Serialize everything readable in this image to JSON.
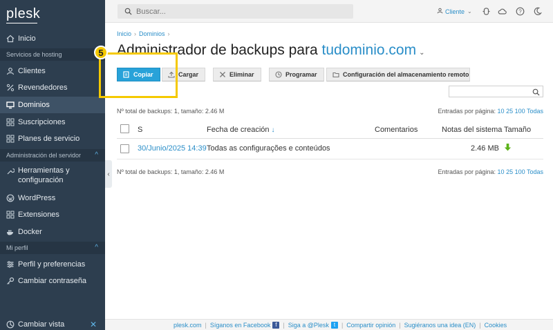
{
  "sidebar": {
    "logo": "plesk",
    "items": [
      {
        "label": "Inicio",
        "icon": "home-icon"
      },
      {
        "section": "Servicios de hosting"
      },
      {
        "label": "Clientes",
        "icon": "user-icon"
      },
      {
        "label": "Revendedores",
        "icon": "percent-icon"
      },
      {
        "label": "Dominios",
        "icon": "monitor-icon",
        "active": true
      },
      {
        "label": "Suscripciones",
        "icon": "grid-icon"
      },
      {
        "label": "Planes de servicio",
        "icon": "grid-icon"
      },
      {
        "section": "Administración del servidor"
      },
      {
        "label": "Herramientas y configuración",
        "icon": "tools-icon"
      },
      {
        "label": "WordPress",
        "icon": "wordpress-icon"
      },
      {
        "label": "Extensiones",
        "icon": "puzzle-icon"
      },
      {
        "label": "Docker",
        "icon": "docker-icon"
      },
      {
        "section": "Mi perfil"
      },
      {
        "label": "Perfil y preferencias",
        "icon": "profile-icon"
      },
      {
        "label": "Cambiar contraseña",
        "icon": "key-icon"
      }
    ],
    "change_view": "Cambiar vista"
  },
  "topbar": {
    "search_placeholder": "Buscar...",
    "user_label": "Cliente"
  },
  "breadcrumb": [
    "Inicio",
    "Dominios"
  ],
  "title": {
    "prefix": "Administrador de backups para",
    "domain": "tudominio.com"
  },
  "step_badge": "5",
  "toolbar": {
    "copy": "Copiar",
    "upload": "Cargar",
    "delete": "Eliminar",
    "schedule": "Programar",
    "remote_storage": "Configuración del almacenamiento remoto"
  },
  "summary": "Nº total de backups: 1, tamaño: 2.46 M",
  "per_page": {
    "label": "Entradas por página:",
    "options": [
      "10",
      "25",
      "100",
      "Todas"
    ]
  },
  "table": {
    "headers": {
      "s": "S",
      "created": "Fecha de creación",
      "sort_indicator": "↓",
      "comments": "Comentarios",
      "notes": "Notas del sistema",
      "size": "Tamaño"
    },
    "rows": [
      {
        "date": "30/Junio/2025 14:39",
        "content": "Todas as configurações e conteúdos",
        "comments": "",
        "notes": "2.46 MB"
      }
    ]
  },
  "footer": {
    "links": [
      "plesk.com",
      "Síganos en Facebook",
      "Siga a @Plesk",
      "Compartir opinión",
      "Sugiéranos una idea (EN)",
      "Cookies"
    ]
  },
  "colors": {
    "sidebar_bg": "#2d3e4f",
    "accent": "#2a8ec8",
    "primary_button": "#28a2d9",
    "highlight": "#f5c900",
    "download_arrow": "#5cb319"
  }
}
